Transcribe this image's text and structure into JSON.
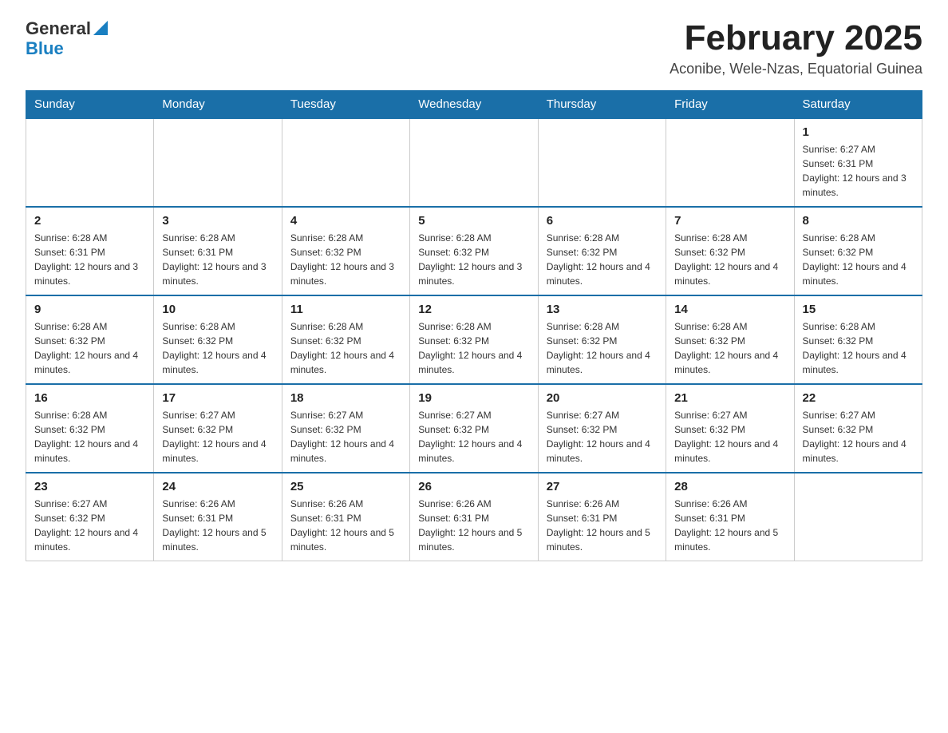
{
  "header": {
    "logo": {
      "general": "General",
      "blue": "Blue"
    },
    "title": "February 2025",
    "subtitle": "Aconibe, Wele-Nzas, Equatorial Guinea"
  },
  "weekdays": [
    "Sunday",
    "Monday",
    "Tuesday",
    "Wednesday",
    "Thursday",
    "Friday",
    "Saturday"
  ],
  "weeks": [
    [
      {
        "day": "",
        "info": ""
      },
      {
        "day": "",
        "info": ""
      },
      {
        "day": "",
        "info": ""
      },
      {
        "day": "",
        "info": ""
      },
      {
        "day": "",
        "info": ""
      },
      {
        "day": "",
        "info": ""
      },
      {
        "day": "1",
        "info": "Sunrise: 6:27 AM\nSunset: 6:31 PM\nDaylight: 12 hours and 3 minutes."
      }
    ],
    [
      {
        "day": "2",
        "info": "Sunrise: 6:28 AM\nSunset: 6:31 PM\nDaylight: 12 hours and 3 minutes."
      },
      {
        "day": "3",
        "info": "Sunrise: 6:28 AM\nSunset: 6:31 PM\nDaylight: 12 hours and 3 minutes."
      },
      {
        "day": "4",
        "info": "Sunrise: 6:28 AM\nSunset: 6:32 PM\nDaylight: 12 hours and 3 minutes."
      },
      {
        "day": "5",
        "info": "Sunrise: 6:28 AM\nSunset: 6:32 PM\nDaylight: 12 hours and 3 minutes."
      },
      {
        "day": "6",
        "info": "Sunrise: 6:28 AM\nSunset: 6:32 PM\nDaylight: 12 hours and 4 minutes."
      },
      {
        "day": "7",
        "info": "Sunrise: 6:28 AM\nSunset: 6:32 PM\nDaylight: 12 hours and 4 minutes."
      },
      {
        "day": "8",
        "info": "Sunrise: 6:28 AM\nSunset: 6:32 PM\nDaylight: 12 hours and 4 minutes."
      }
    ],
    [
      {
        "day": "9",
        "info": "Sunrise: 6:28 AM\nSunset: 6:32 PM\nDaylight: 12 hours and 4 minutes."
      },
      {
        "day": "10",
        "info": "Sunrise: 6:28 AM\nSunset: 6:32 PM\nDaylight: 12 hours and 4 minutes."
      },
      {
        "day": "11",
        "info": "Sunrise: 6:28 AM\nSunset: 6:32 PM\nDaylight: 12 hours and 4 minutes."
      },
      {
        "day": "12",
        "info": "Sunrise: 6:28 AM\nSunset: 6:32 PM\nDaylight: 12 hours and 4 minutes."
      },
      {
        "day": "13",
        "info": "Sunrise: 6:28 AM\nSunset: 6:32 PM\nDaylight: 12 hours and 4 minutes."
      },
      {
        "day": "14",
        "info": "Sunrise: 6:28 AM\nSunset: 6:32 PM\nDaylight: 12 hours and 4 minutes."
      },
      {
        "day": "15",
        "info": "Sunrise: 6:28 AM\nSunset: 6:32 PM\nDaylight: 12 hours and 4 minutes."
      }
    ],
    [
      {
        "day": "16",
        "info": "Sunrise: 6:28 AM\nSunset: 6:32 PM\nDaylight: 12 hours and 4 minutes."
      },
      {
        "day": "17",
        "info": "Sunrise: 6:27 AM\nSunset: 6:32 PM\nDaylight: 12 hours and 4 minutes."
      },
      {
        "day": "18",
        "info": "Sunrise: 6:27 AM\nSunset: 6:32 PM\nDaylight: 12 hours and 4 minutes."
      },
      {
        "day": "19",
        "info": "Sunrise: 6:27 AM\nSunset: 6:32 PM\nDaylight: 12 hours and 4 minutes."
      },
      {
        "day": "20",
        "info": "Sunrise: 6:27 AM\nSunset: 6:32 PM\nDaylight: 12 hours and 4 minutes."
      },
      {
        "day": "21",
        "info": "Sunrise: 6:27 AM\nSunset: 6:32 PM\nDaylight: 12 hours and 4 minutes."
      },
      {
        "day": "22",
        "info": "Sunrise: 6:27 AM\nSunset: 6:32 PM\nDaylight: 12 hours and 4 minutes."
      }
    ],
    [
      {
        "day": "23",
        "info": "Sunrise: 6:27 AM\nSunset: 6:32 PM\nDaylight: 12 hours and 4 minutes."
      },
      {
        "day": "24",
        "info": "Sunrise: 6:26 AM\nSunset: 6:31 PM\nDaylight: 12 hours and 5 minutes."
      },
      {
        "day": "25",
        "info": "Sunrise: 6:26 AM\nSunset: 6:31 PM\nDaylight: 12 hours and 5 minutes."
      },
      {
        "day": "26",
        "info": "Sunrise: 6:26 AM\nSunset: 6:31 PM\nDaylight: 12 hours and 5 minutes."
      },
      {
        "day": "27",
        "info": "Sunrise: 6:26 AM\nSunset: 6:31 PM\nDaylight: 12 hours and 5 minutes."
      },
      {
        "day": "28",
        "info": "Sunrise: 6:26 AM\nSunset: 6:31 PM\nDaylight: 12 hours and 5 minutes."
      },
      {
        "day": "",
        "info": ""
      }
    ]
  ]
}
